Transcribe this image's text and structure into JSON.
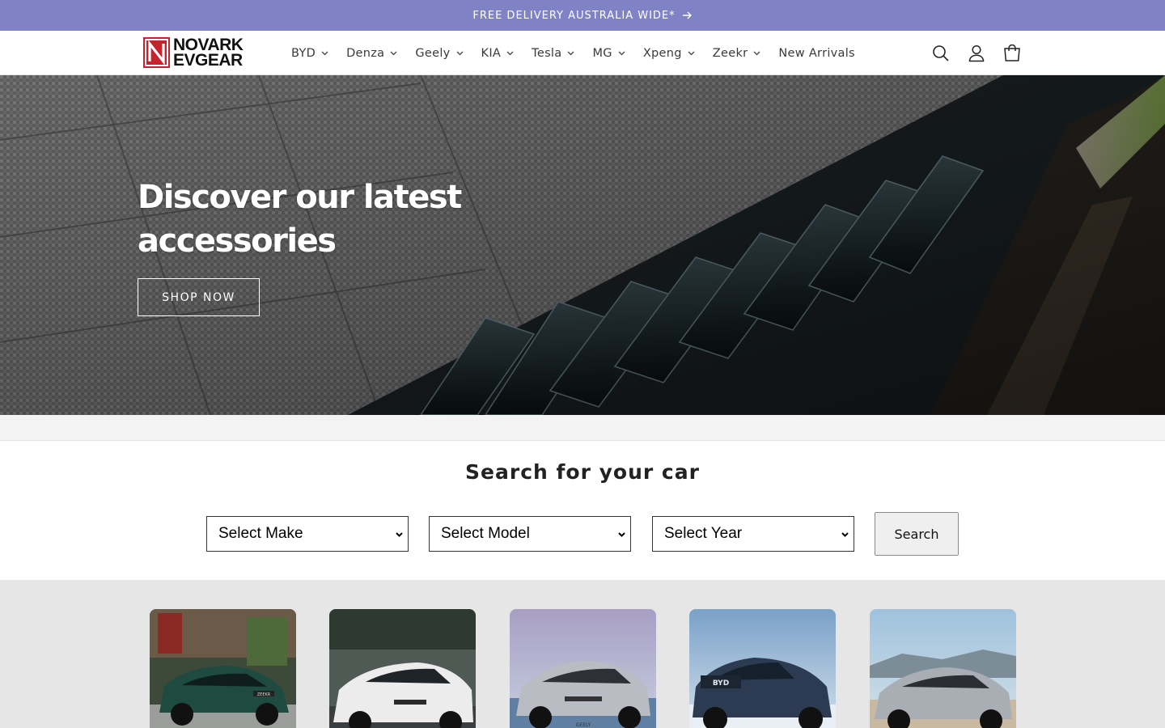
{
  "announcement": {
    "text": "FREE DELIVERY AUSTRALIA WIDE*",
    "icon": "arrow-right-icon"
  },
  "header": {
    "logo": {
      "line1": "NOVARK",
      "line2": "EVGEAR"
    },
    "nav": [
      {
        "label": "BYD",
        "has_dropdown": true
      },
      {
        "label": "Denza",
        "has_dropdown": true
      },
      {
        "label": "Geely",
        "has_dropdown": true
      },
      {
        "label": "KIA",
        "has_dropdown": true
      },
      {
        "label": "Tesla",
        "has_dropdown": true
      },
      {
        "label": "MG",
        "has_dropdown": true
      },
      {
        "label": "Xpeng",
        "has_dropdown": true
      },
      {
        "label": "Zeekr",
        "has_dropdown": true
      },
      {
        "label": "New Arrivals",
        "has_dropdown": false
      }
    ],
    "icons": [
      "search-icon",
      "account-icon",
      "cart-icon"
    ]
  },
  "hero": {
    "title_line1": "Discover our latest",
    "title_line2": "accessories",
    "button_label": "SHOP NOW"
  },
  "search": {
    "title": "Search for your car",
    "make": "Select Make",
    "model": "Select Model",
    "year": "Select Year",
    "button_label": "Search"
  },
  "cards": [
    {
      "name": "zeekr-card",
      "plate": "ZEEKR",
      "bg": "#3d4a3a",
      "car_color": "#1f4a3f"
    },
    {
      "name": "tesla-card",
      "plate": "",
      "bg": "#505a55",
      "car_color": "#ececec"
    },
    {
      "name": "geely-card",
      "plate": "GEELY",
      "bg": "#9aa8c4",
      "car_color": "#b9bcc2"
    },
    {
      "name": "byd-shark-card",
      "plate": "BYD",
      "bg": "#8fb0cf",
      "car_color": "#2c3b52"
    },
    {
      "name": "byd-seal-card",
      "plate": "",
      "bg": "#b3c9d9",
      "car_color": "#a9adb4"
    }
  ],
  "colors": {
    "announcement_bg": "#7f83c6",
    "brand_red": "#c8232c"
  }
}
